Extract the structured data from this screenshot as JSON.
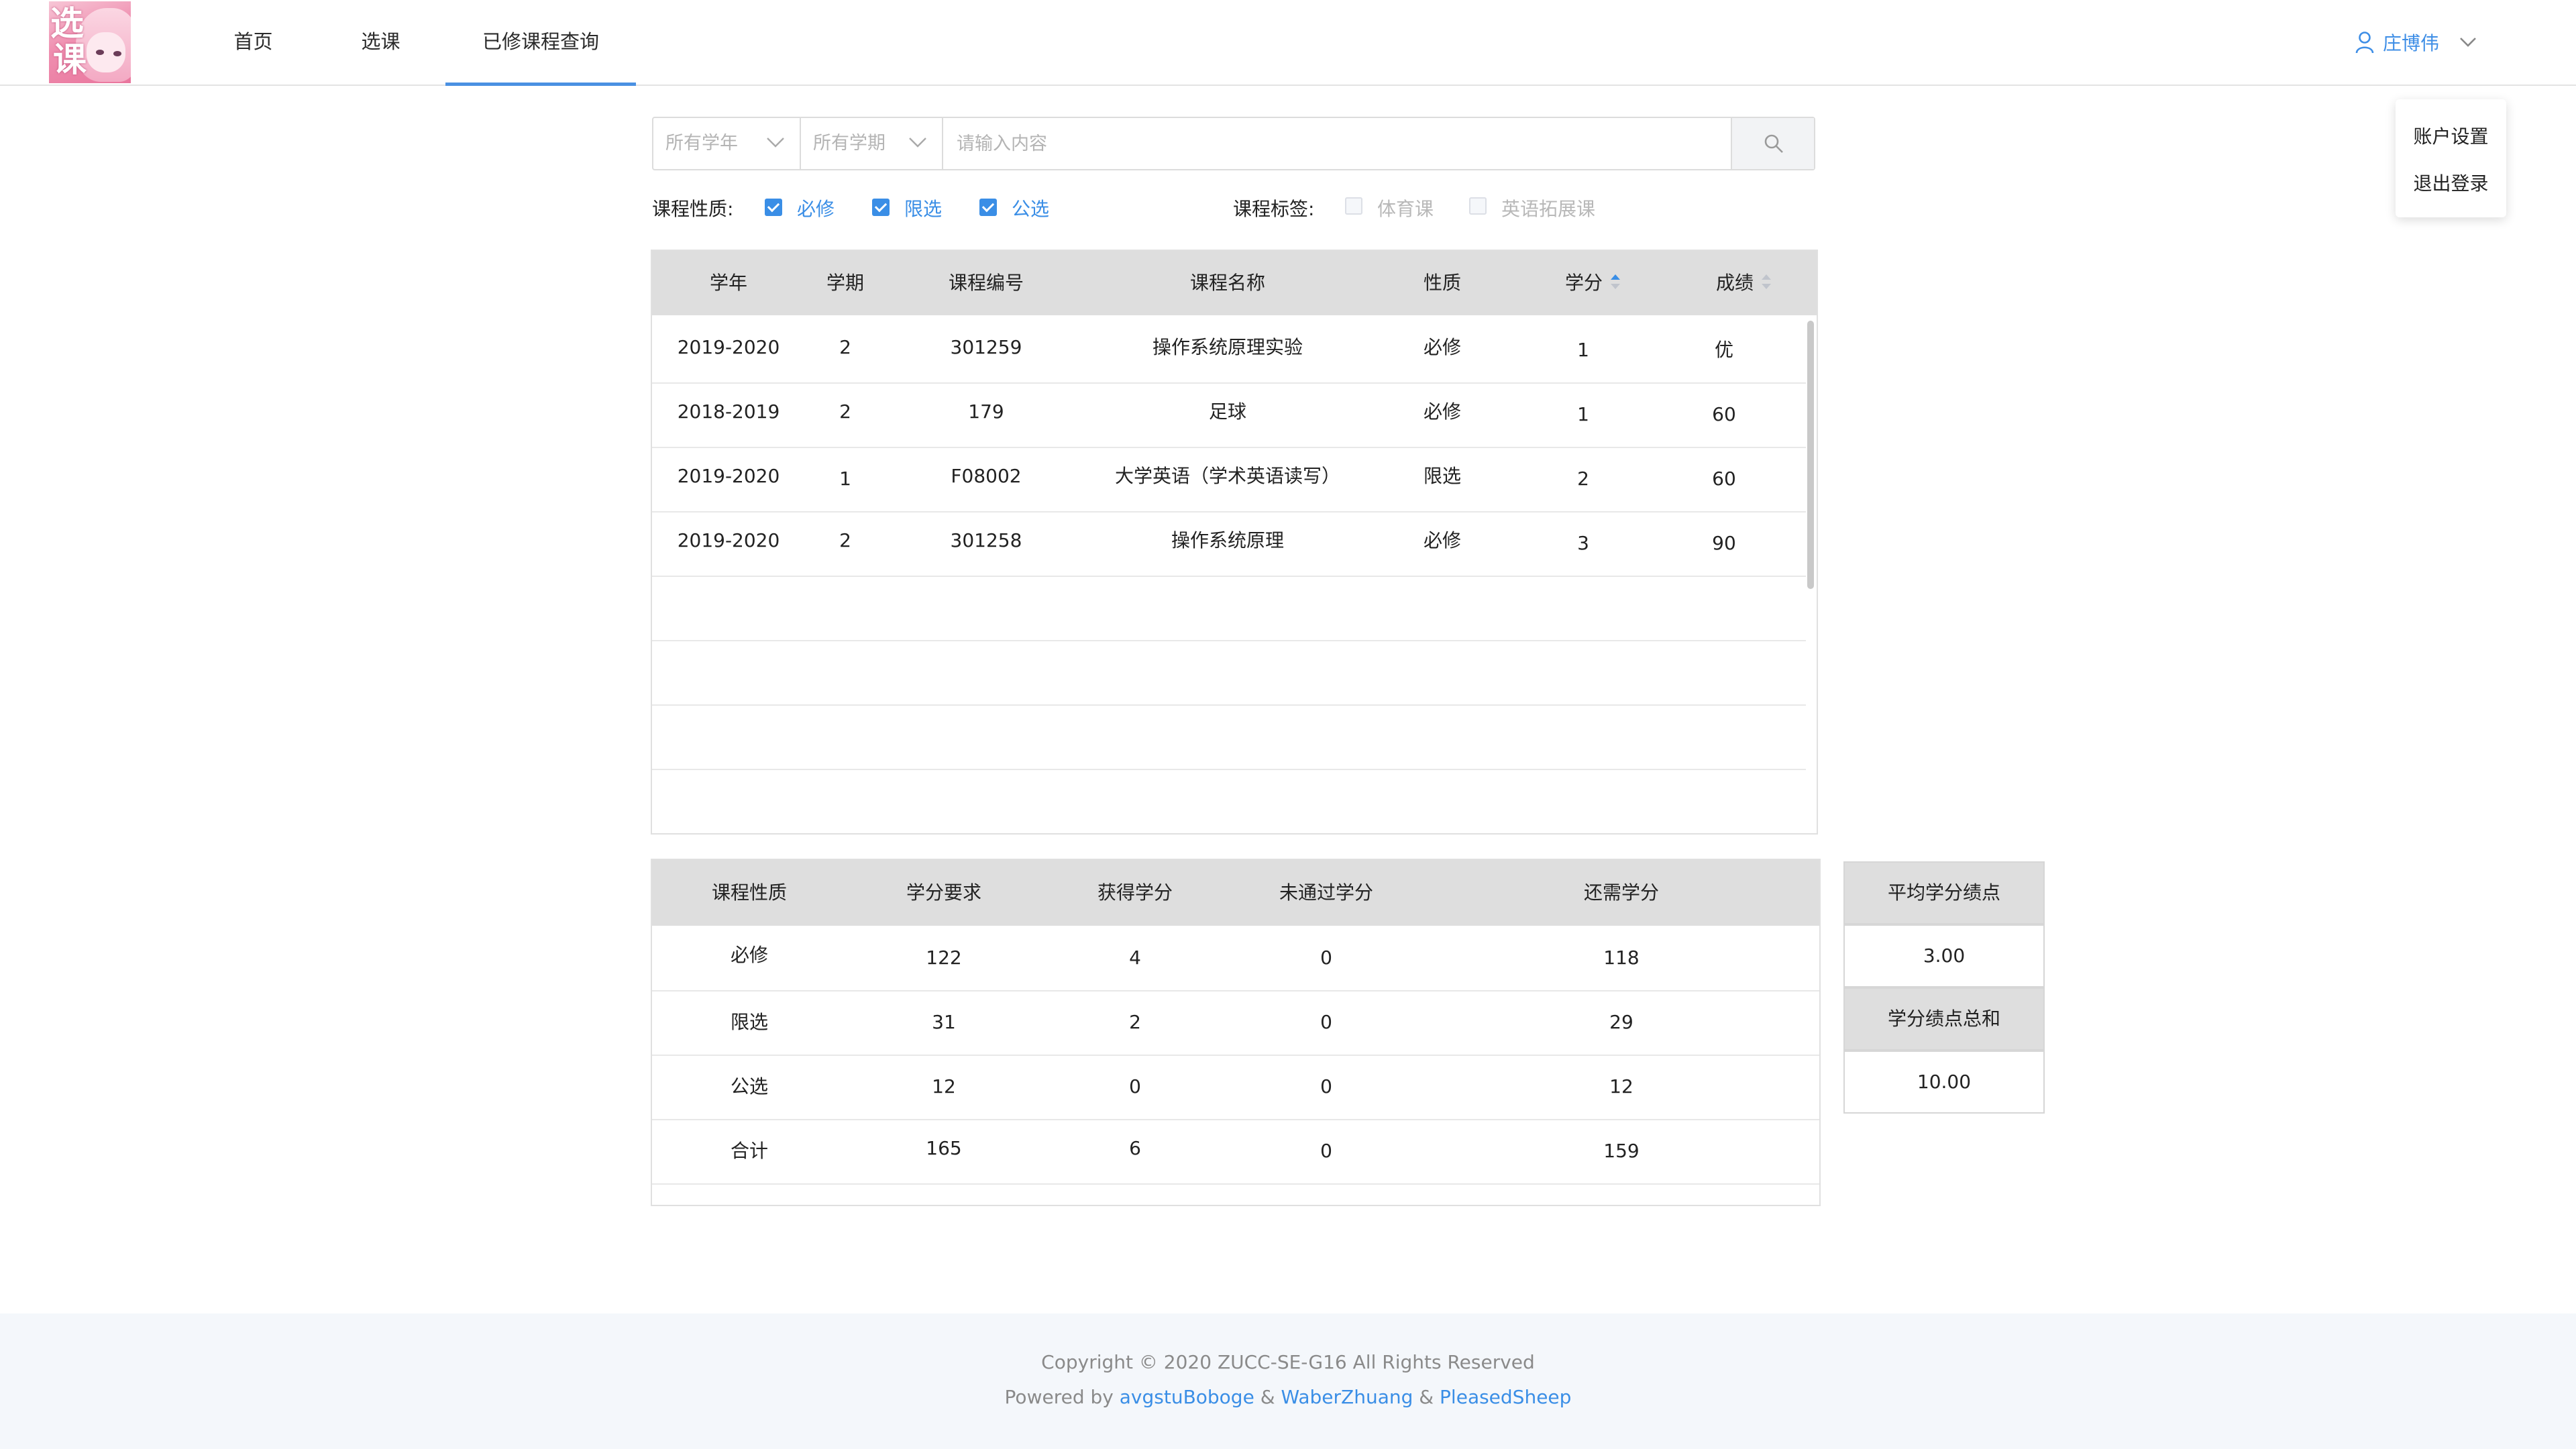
{
  "header": {
    "logo_text": [
      "选",
      "课"
    ],
    "nav": [
      {
        "label": "首页"
      },
      {
        "label": "选课"
      },
      {
        "label": "已修课程查询",
        "active": true
      }
    ],
    "user_name": "庄博伟",
    "icons": {
      "user": "user-icon",
      "dropdown": "chevron-down-icon"
    }
  },
  "dropdown": {
    "items": [
      "账户设置",
      "退出登录"
    ]
  },
  "search": {
    "year_select": "所有学年",
    "term_select": "所有学期",
    "placeholder": "请输入内容",
    "button_icon": "search-icon"
  },
  "filters": {
    "nature_label": "课程性质:",
    "nature_options": [
      {
        "label": "必修",
        "checked": true
      },
      {
        "label": "限选",
        "checked": true
      },
      {
        "label": "公选",
        "checked": true
      }
    ],
    "tag_label": "课程标签:",
    "tag_options": [
      {
        "label": "体育课",
        "checked": false,
        "disabled": true
      },
      {
        "label": "英语拓展课",
        "checked": false,
        "disabled": true
      }
    ]
  },
  "courses": {
    "columns": [
      "学年",
      "学期",
      "课程编号",
      "课程名称",
      "性质",
      "学分",
      "成绩"
    ],
    "sort_state": {
      "学分": "ascending",
      "成绩": "none"
    },
    "rows": [
      {
        "year": "2019-2020",
        "term": "2",
        "code": "301259",
        "name": "操作系统原理实验",
        "nature": "必修",
        "credit": "1",
        "score": "优"
      },
      {
        "year": "2018-2019",
        "term": "2",
        "code": "179",
        "name": "足球",
        "nature": "必修",
        "credit": "1",
        "score": "60"
      },
      {
        "year": "2019-2020",
        "term": "1",
        "code": "F08002",
        "name": "大学英语（学术英语读写）",
        "nature": "限选",
        "credit": "2",
        "score": "60"
      },
      {
        "year": "2019-2020",
        "term": "2",
        "code": "301258",
        "name": "操作系统原理",
        "nature": "必修",
        "credit": "3",
        "score": "90"
      }
    ]
  },
  "summary": {
    "columns": [
      "课程性质",
      "学分要求",
      "获得学分",
      "未通过学分",
      "还需学分"
    ],
    "rows": [
      {
        "nature": "必修",
        "required": "122",
        "earned": "4",
        "failed": "0",
        "remaining": "118"
      },
      {
        "nature": "限选",
        "required": "31",
        "earned": "2",
        "failed": "0",
        "remaining": "29"
      },
      {
        "nature": "公选",
        "required": "12",
        "earned": "0",
        "failed": "0",
        "remaining": "12"
      },
      {
        "nature": "合计",
        "required": "165",
        "earned": "6",
        "failed": "0",
        "remaining": "159"
      }
    ]
  },
  "gpa": {
    "avg_label": "平均学分绩点",
    "avg_value": "3.00",
    "sum_label": "学分绩点总和",
    "sum_value": "10.00"
  },
  "footer": {
    "copyright": "Copyright © 2020 ZUCC-SE-G16 All Rights Reserved",
    "powered_prefix": "Powered by",
    "authors": [
      "avgstuBoboge",
      "WaberZhuang",
      "PleasedSheep"
    ],
    "separator": "&"
  },
  "colors": {
    "accent": "#3a8ee6",
    "header_row_bg": "#dedede",
    "footer_bg": "#f4f7fb"
  }
}
